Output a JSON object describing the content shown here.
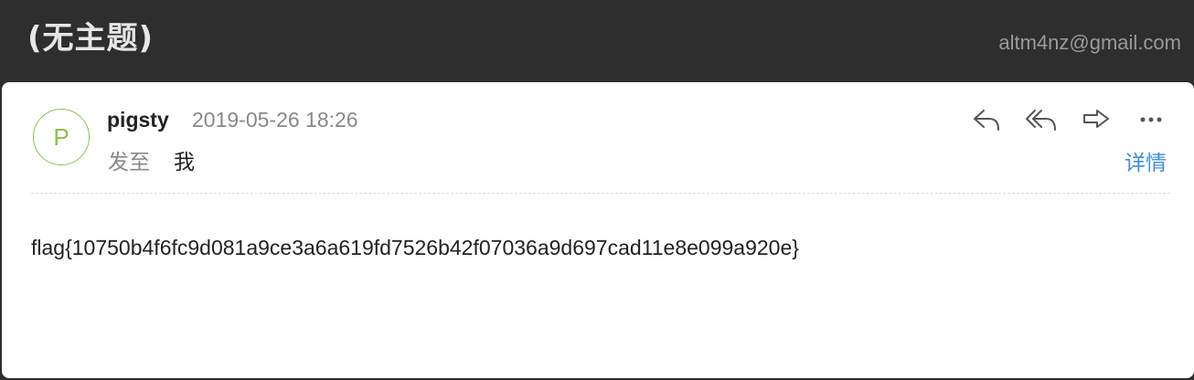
{
  "header": {
    "subject": "(无主题)",
    "account": "altm4nz@gmail.com"
  },
  "message": {
    "avatar_letter": "P",
    "sender": "pigsty",
    "date": "2019-05-26 18:26",
    "to_label": "发至",
    "to_value": "我",
    "details_label": "详情",
    "body": "flag{10750b4f6fc9d081a9ce3a6a619fd7526b42f07036a9d697cad11e8e099a920e}"
  },
  "actions": [
    {
      "name": "reply-icon"
    },
    {
      "name": "reply-all-icon"
    },
    {
      "name": "forward-icon"
    },
    {
      "name": "more-icon"
    }
  ],
  "colors": {
    "header_bg": "#2e2e2e",
    "avatar": "#8bc34a",
    "link": "#3a8ee6"
  }
}
